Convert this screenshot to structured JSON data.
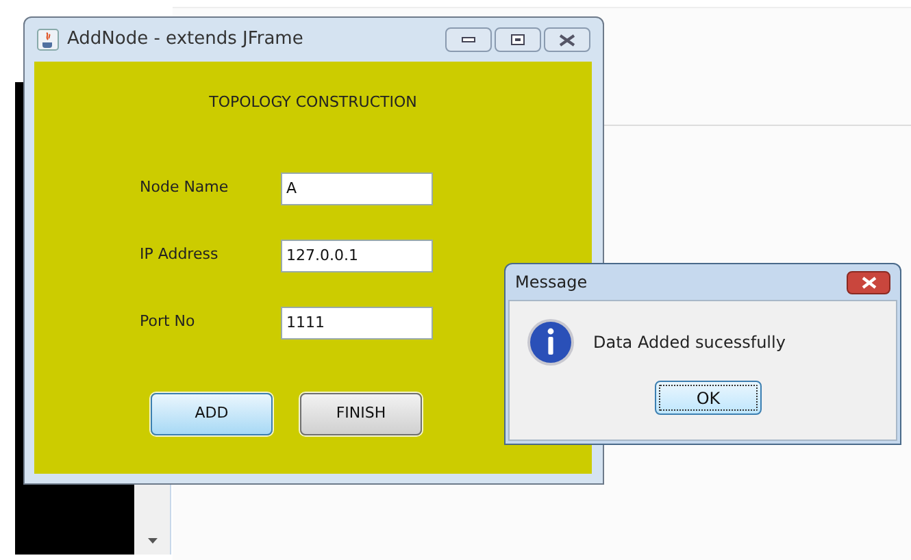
{
  "main_window": {
    "title": "AddNode - extends JFrame",
    "heading": "TOPOLOGY CONSTRUCTION",
    "fields": [
      {
        "label": "Node Name",
        "value": "A"
      },
      {
        "label": "IP Address",
        "value": "127.0.0.1"
      },
      {
        "label": "Port No",
        "value": "1111"
      }
    ],
    "buttons": [
      {
        "label": "ADD",
        "selected": true
      },
      {
        "label": "FINISH",
        "selected": false
      }
    ]
  },
  "message_dialog": {
    "title": "Message",
    "text": "Data Added sucessfully",
    "button": "OK"
  }
}
